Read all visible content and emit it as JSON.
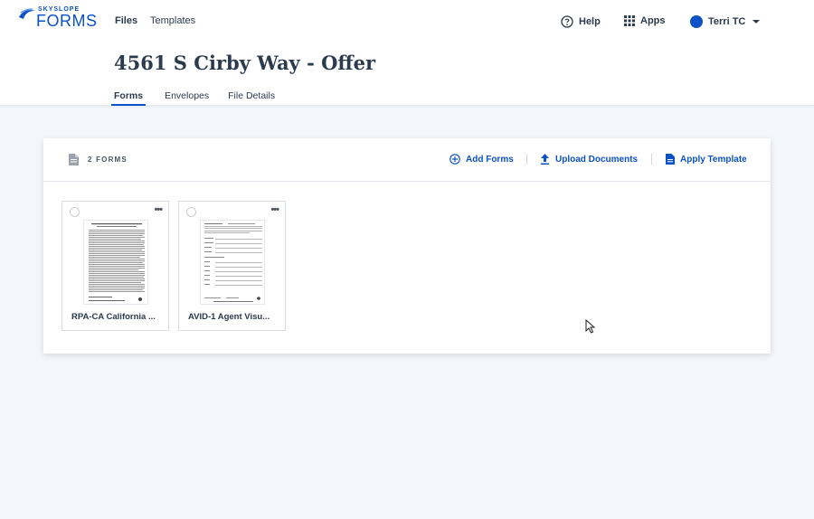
{
  "brand": {
    "small": "SKYSLOPE",
    "big": "FORMS"
  },
  "nav": {
    "files": "Files",
    "templates": "Templates"
  },
  "top_right": {
    "help": "Help",
    "apps": "Apps",
    "user": "Terri TC"
  },
  "page": {
    "title": "4561 S Cirby Way - Offer"
  },
  "tabs": [
    {
      "label": "Forms",
      "active": true
    },
    {
      "label": "Envelopes",
      "active": false
    },
    {
      "label": "File Details",
      "active": false
    }
  ],
  "panel": {
    "count_label": "2 FORMS",
    "add_forms": "Add Forms",
    "upload_documents": "Upload Documents",
    "apply_template": "Apply Template"
  },
  "forms": [
    {
      "name": "RPA-CA California ...",
      "more": "•••"
    },
    {
      "name": "AVID-1 Agent Visu...",
      "more": "•••"
    }
  ],
  "colors": {
    "accent": "#0b52c7",
    "text": "#2b3a4e",
    "background": "#f3f6fb"
  }
}
